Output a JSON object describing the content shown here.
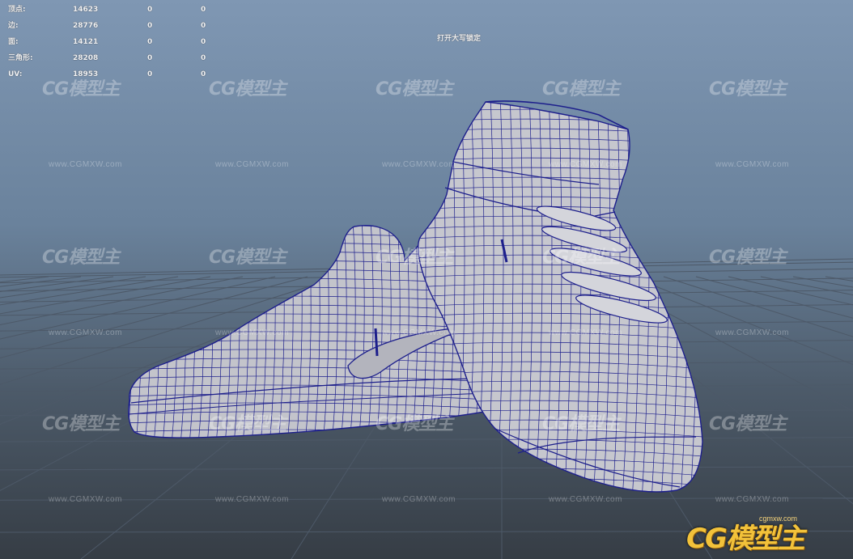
{
  "hud": {
    "rows": [
      {
        "label": "顶点:",
        "v1": "14623",
        "v2": "0",
        "v3": "0"
      },
      {
        "label": "边:",
        "v1": "28776",
        "v2": "0",
        "v3": "0"
      },
      {
        "label": "面:",
        "v1": "14121",
        "v2": "0",
        "v3": "0"
      },
      {
        "label": "三角形:",
        "v1": "28208",
        "v2": "0",
        "v3": "0"
      },
      {
        "label": "UV:",
        "v1": "18953",
        "v2": "0",
        "v3": "0"
      }
    ],
    "caps_lock_message": "打开大写锁定"
  },
  "watermark": {
    "logo_text": "CG模型主",
    "url_text": "www.CGMXW.com"
  },
  "brand": {
    "logo_text": "CG模型主",
    "url_text": "cgmxw.com"
  },
  "colors": {
    "wireframe": "#1d1f8c",
    "shoe_surface": "#c3c4cb",
    "grid_line": "#4d5968"
  }
}
